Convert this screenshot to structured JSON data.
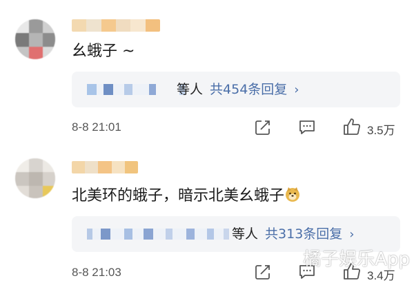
{
  "comments": [
    {
      "text": "幺蛾子 ~",
      "reply": {
        "others": "等人",
        "count": "共454条回复",
        "chevron": "›"
      },
      "time": "8-8 21:01",
      "likes": "3.5万"
    },
    {
      "text": "北美环的蛾子，暗示北美幺蛾子",
      "reply": {
        "others": "等人",
        "count": "共313条回复",
        "chevron": "›"
      },
      "time": "8-8 21:03",
      "likes": "3.4万"
    }
  ],
  "icons": {
    "share": "share-icon",
    "comment": "comment-icon",
    "like": "thumbs-up-icon",
    "emoji": "doge-emoji-icon"
  },
  "watermark": "橘子娱乐App",
  "colors": {
    "link": "#4a6ea8",
    "reply_bg": "#f4f5f7"
  }
}
